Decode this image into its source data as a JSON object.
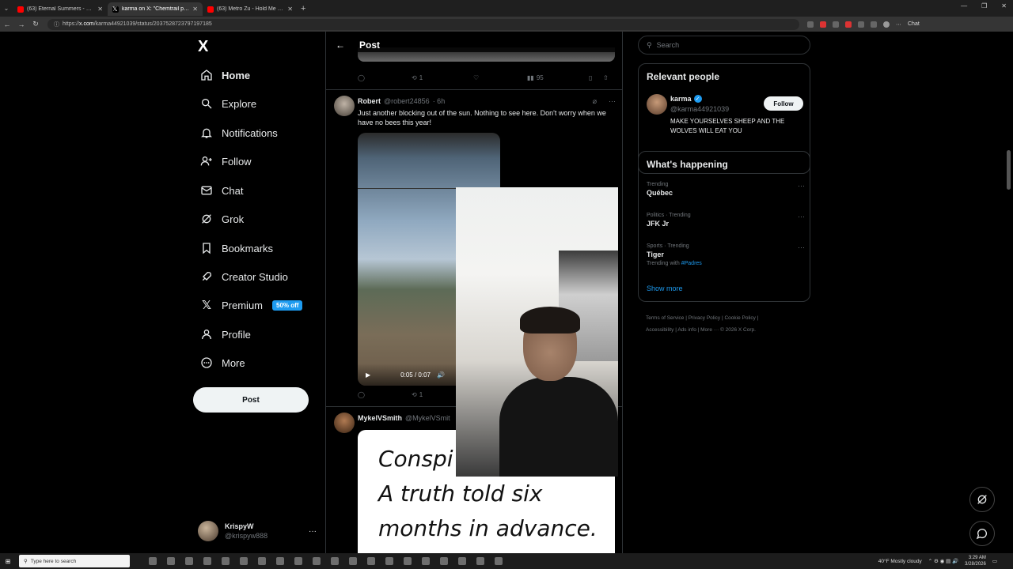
{
  "browser": {
    "tabs": [
      {
        "title": "(63) Eternal Summers - Pure Affect",
        "favicon_color": "#ff0000",
        "active": false
      },
      {
        "title": "karma on X: \"Chemtrail pilots fin",
        "favicon_color": "#ffffff",
        "active": true
      },
      {
        "title": "(63) Metro Zu - Hold Me Dow",
        "favicon_color": "#ff0000",
        "active": false
      }
    ],
    "url_prefix": "https://",
    "url_host": "x.com",
    "url_path": "/karma44921039/status/2037528723797197185",
    "chat_label": "Chat"
  },
  "nav": {
    "logo": "X",
    "items": [
      {
        "label": "Home",
        "icon": "home-icon"
      },
      {
        "label": "Explore",
        "icon": "search-icon"
      },
      {
        "label": "Notifications",
        "icon": "bell-icon"
      },
      {
        "label": "Follow",
        "icon": "person-add-icon"
      },
      {
        "label": "Chat",
        "icon": "mail-icon"
      },
      {
        "label": "Grok",
        "icon": "grok-icon"
      },
      {
        "label": "Bookmarks",
        "icon": "bookmark-icon"
      },
      {
        "label": "Creator Studio",
        "icon": "rocket-icon"
      },
      {
        "label": "Premium",
        "icon": "x-icon"
      },
      {
        "label": "Profile",
        "icon": "person-icon"
      },
      {
        "label": "More",
        "icon": "more-circle-icon"
      }
    ],
    "premium_badge": "50% off",
    "post_button": "Post",
    "account": {
      "name": "KrispyW",
      "handle": "@krispyw888"
    }
  },
  "main": {
    "title": "Post",
    "prev_actions": {
      "retweets": "1",
      "views": "95"
    },
    "tweet1": {
      "name": "Robert",
      "handle": "@robert24856",
      "time": "· 6h",
      "text": "Just another blocking out of the sun. Nothing to see here. Don't worry when we have no bees this year!",
      "video_time": "0:05 / 0:07",
      "retweets": "1"
    },
    "tweet2": {
      "name": "MykelVSmith",
      "handle": "@MykelVSmit",
      "image_lines": [
        "Conspi",
        "A truth told six",
        "months in advance."
      ]
    }
  },
  "right": {
    "search_placeholder": "Search",
    "relevant_title": "Relevant people",
    "person": {
      "name": "karma",
      "handle": "@karma44921039",
      "follow": "Follow",
      "bio": "MAKE YOURSELVES SHEEP AND THE WOLVES WILL EAT YOU"
    },
    "happening_title": "What's happening",
    "trends": [
      {
        "meta": "Trending",
        "title": "Québec",
        "with": ""
      },
      {
        "meta": "Politics · Trending",
        "title": "JFK Jr",
        "with": ""
      },
      {
        "meta": "Sports · Trending",
        "title": "Tiger",
        "with_prefix": "Trending with",
        "with_tag": "#Padres"
      }
    ],
    "show_more": "Show more",
    "footer_line1": "Terms of Service  |  Privacy Policy  |  Cookie Policy  |",
    "footer_line2": "Accessibility  |  Ads info  |  More ···  © 2026 X Corp."
  },
  "taskbar": {
    "search_placeholder": "Type here to search",
    "weather": "40°F  Mostly cloudy",
    "time": "3:29 AM",
    "date": "3/28/2026"
  }
}
